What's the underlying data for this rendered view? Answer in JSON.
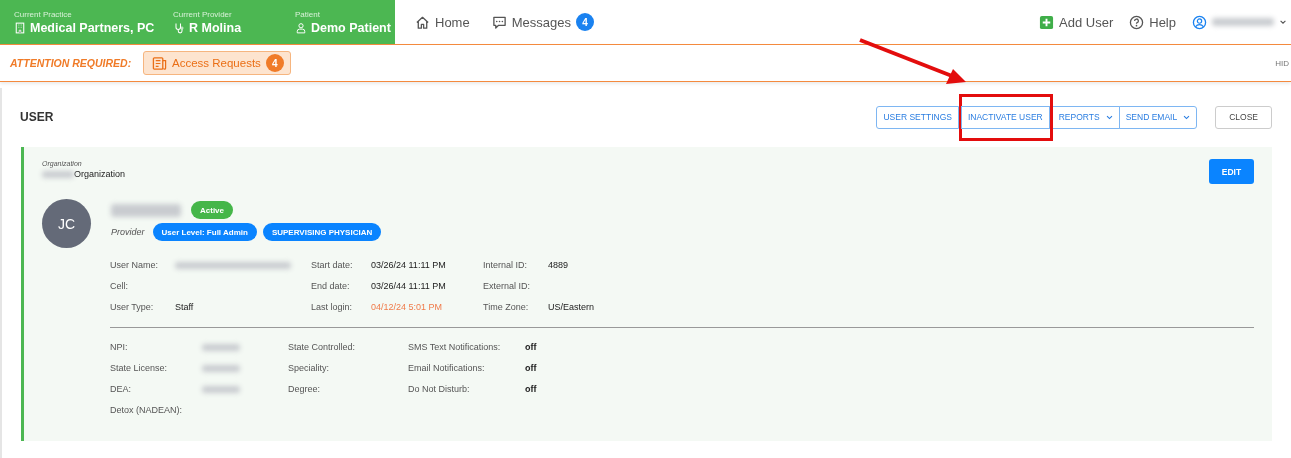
{
  "top_bar": {
    "context": [
      {
        "label": "Current Practice",
        "value": "Medical Partners, PC"
      },
      {
        "label": "Current Provider",
        "value": "R Molina"
      },
      {
        "label": "Patient",
        "value": "Demo Patient"
      }
    ],
    "nav": [
      {
        "label": "Home"
      },
      {
        "label": "Messages",
        "badge": "4"
      }
    ],
    "right": [
      {
        "label": "Add User"
      },
      {
        "label": "Help"
      }
    ]
  },
  "attention": {
    "label": "ATTENTION REQUIRED:",
    "button": {
      "label": "Access Requests",
      "badge": "4"
    },
    "hide": "HID"
  },
  "page": {
    "title": "USER",
    "actions": [
      {
        "label": "USER SETTINGS",
        "dropdown": false,
        "highlighted": false
      },
      {
        "label": "INACTIVATE USER",
        "dropdown": false,
        "highlighted": true
      },
      {
        "label": "REPORTS",
        "dropdown": true,
        "highlighted": false
      },
      {
        "label": "SEND EMAIL",
        "dropdown": true,
        "highlighted": false
      }
    ],
    "close": "CLOSE"
  },
  "card": {
    "org_label": "Organization",
    "org_name": "Organization",
    "initials": "JC",
    "status": "Active",
    "role": "Provider",
    "badges": [
      "User Level: Full Admin",
      "SUPERVISING PHYSICIAN"
    ],
    "edit": "EDIT",
    "details": [
      [
        {
          "label": "User Name:",
          "redacted": true
        },
        {
          "label": "Cell:"
        },
        {
          "label": "User Type:",
          "value": "Staff"
        }
      ],
      [
        {
          "label": "Start date:",
          "value": "03/26/24 11:11 PM"
        },
        {
          "label": "End date:",
          "value": "03/26/44 11:11 PM"
        },
        {
          "label": "Last login:",
          "value": "04/12/24 5:01 PM",
          "alert": true
        }
      ],
      [
        {
          "label": "Internal ID:",
          "value": "4889"
        },
        {
          "label": "External ID:"
        },
        {
          "label": "Time Zone:",
          "value": "US/Eastern"
        }
      ]
    ],
    "more": [
      [
        {
          "label": "NPI:",
          "redacted": true
        },
        {
          "label": "State License:",
          "redacted": true
        },
        {
          "label": "DEA:",
          "redacted": true
        },
        {
          "label": "Detox (NADEAN):"
        }
      ],
      [
        {
          "label": "State Controlled:"
        },
        {
          "label": "Speciality:"
        },
        {
          "label": "Degree:"
        }
      ],
      [
        {
          "label": "SMS Text Notifications:",
          "value": "off"
        },
        {
          "label": "Email Notifications:",
          "value": "off"
        },
        {
          "label": "Do Not Disturb:",
          "value": "off"
        }
      ]
    ]
  }
}
